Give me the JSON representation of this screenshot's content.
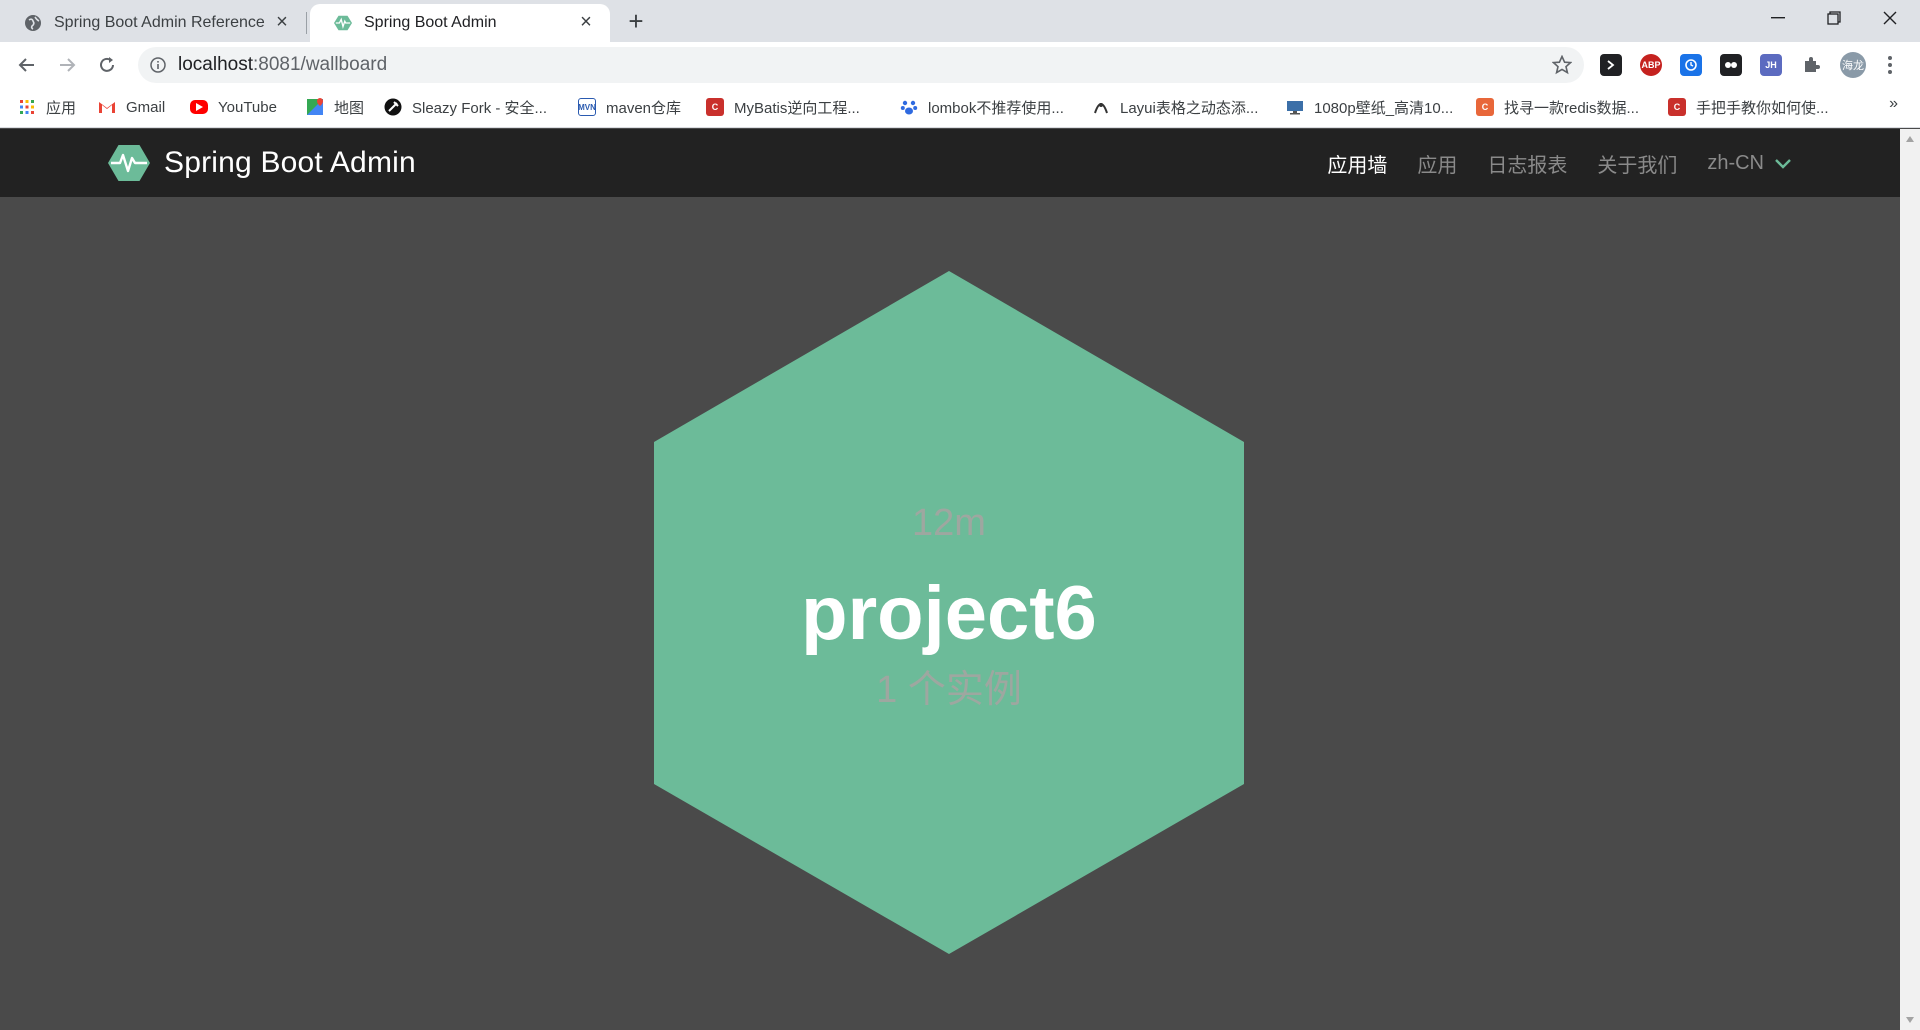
{
  "browser": {
    "tabs": [
      {
        "title": "Spring Boot Admin Reference",
        "active": false
      },
      {
        "title": "Spring Boot Admin",
        "active": true
      }
    ],
    "address": {
      "host": "localhost",
      "rest": ":8081/wallboard"
    },
    "bookmarks": [
      {
        "label": "应用",
        "icon": "apps-grid-icon"
      },
      {
        "label": "Gmail",
        "icon": "gmail-icon"
      },
      {
        "label": "YouTube",
        "icon": "youtube-icon"
      },
      {
        "label": "地图",
        "icon": "maps-icon"
      },
      {
        "label": "Sleazy Fork - 安全...",
        "icon": "sleazyfork-icon"
      },
      {
        "label": "maven仓库",
        "icon": "mvn-icon"
      },
      {
        "label": "MyBatis逆向工程...",
        "icon": "csdn-icon"
      },
      {
        "label": "lombok不推荐使用...",
        "icon": "baidu-paw-icon"
      },
      {
        "label": "Layui表格之动态添...",
        "icon": "layui-icon"
      },
      {
        "label": "1080p壁纸_高清10...",
        "icon": "monitor-icon"
      },
      {
        "label": "找寻一款redis数据...",
        "icon": "csdn-icon"
      },
      {
        "label": "手把手教你如何使...",
        "icon": "csdn-icon"
      }
    ],
    "profile_label": "海龙",
    "extensions": [
      "ABP",
      "JH"
    ]
  },
  "app": {
    "brand": "Spring Boot Admin",
    "nav": [
      {
        "label": "应用墙",
        "active": true
      },
      {
        "label": "应用",
        "active": false
      },
      {
        "label": "日志报表",
        "active": false
      },
      {
        "label": "关于我们",
        "active": false
      }
    ],
    "language": "zh-CN"
  },
  "wallboard": {
    "application": {
      "uptime": "12m",
      "name": "project6",
      "instances": "1 个实例",
      "status_color": "#6cbb99"
    }
  },
  "colors": {
    "accent": "#6cbb99",
    "navbar": "#222222",
    "background": "#4a4a4a"
  }
}
